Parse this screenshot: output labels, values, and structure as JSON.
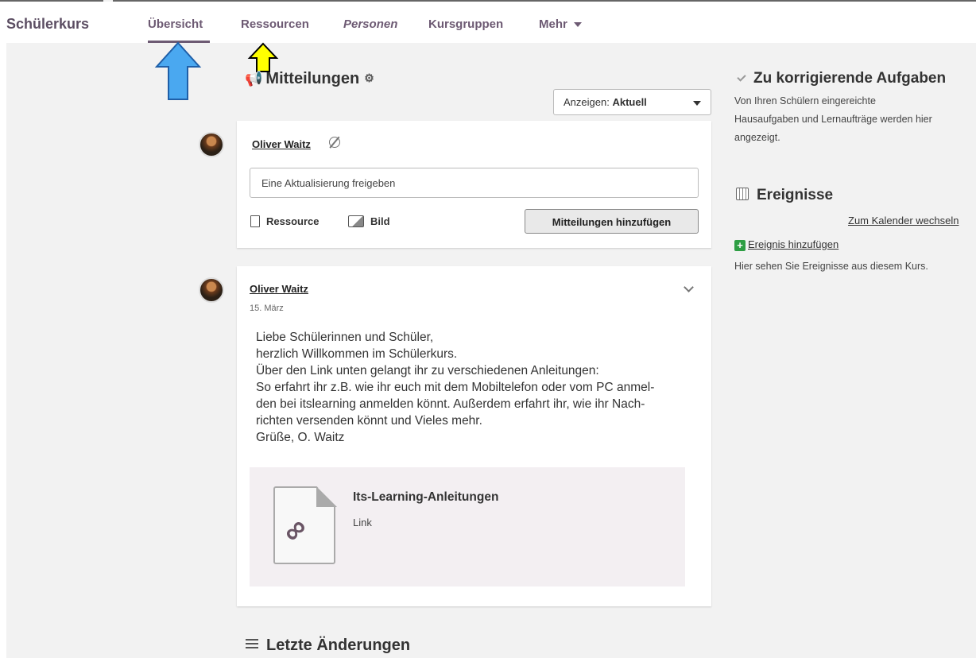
{
  "nav": {
    "brand": "Schülerkurs",
    "items": [
      {
        "label": "Übersicht"
      },
      {
        "label": "Ressourcen"
      },
      {
        "label": "Personen"
      },
      {
        "label": "Kursgruppen"
      },
      {
        "label": "Mehr"
      }
    ]
  },
  "colors": {
    "accent": "#6d5a73",
    "blue_arrow": "#4aa8f0",
    "yellow_arrow": "#ffff00"
  },
  "announcements": {
    "title": "Mitteilungen",
    "filter_label": "Anzeigen:",
    "filter_value": "Aktuell",
    "composer": {
      "user": "Oliver Waitz",
      "placeholder": "Eine Aktualisierung freigeben",
      "attach_resource": "Ressource",
      "attach_image": "Bild",
      "submit": "Mitteilungen hinzufügen"
    },
    "post": {
      "author": "Oliver Waitz",
      "date": "15. März",
      "lines": [
        "Liebe Schülerinnen und Schüler,",
        "herzlich Willkommen im Schülerkurs.",
        "Über den Link unten gelangt ihr zu verschiedenen Anleitungen:",
        "So erfahrt ihr z.B. wie ihr euch mit dem Mobiltelefon oder vom PC anmel-",
        "den bei itslearning anmelden könnt. Außerdem erfahrt ihr, wie ihr Nach-",
        "richten versenden könnt und Vieles mehr.",
        "Grüße, O. Waitz"
      ],
      "resource": {
        "title": "Its-Learning-Anleitungen",
        "type": "Link"
      }
    }
  },
  "recent_changes": {
    "title": "Letzte Änderungen"
  },
  "sidebar": {
    "tasks": {
      "title": "Zu korrigierende Aufgaben",
      "text_lines": [
        "Von Ihren Schülern eingereichte",
        "Hausaufgaben und Lernaufträge werden hier",
        "angezeigt."
      ]
    },
    "events": {
      "title": "Ereignisse",
      "calendar_link": "Zum Kalender wechseln",
      "add_event": "Ereignis hinzufügen",
      "info": "Hier sehen Sie Ereignisse aus diesem Kurs."
    }
  }
}
